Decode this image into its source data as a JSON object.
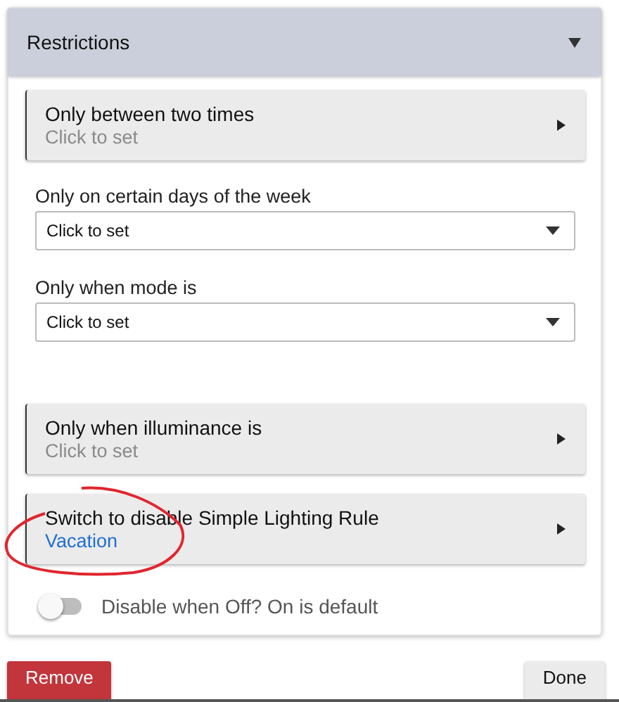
{
  "section": {
    "title": "Restrictions",
    "expanded": true
  },
  "items": [
    {
      "kind": "link",
      "label": "Only between two times",
      "value": "Click to set",
      "value_set": false
    },
    {
      "kind": "select",
      "label": "Only on certain days of the week",
      "value": "Click to set"
    },
    {
      "kind": "select",
      "label": "Only when mode is",
      "value": "Click to set"
    },
    {
      "kind": "link",
      "label": "Only when illuminance is",
      "value": "Click to set",
      "value_set": false
    },
    {
      "kind": "link",
      "label": "Switch to disable Simple Lighting Rule",
      "value": "Vacation",
      "value_set": true
    }
  ],
  "toggle": {
    "label": "Disable when Off? On is default",
    "on": false
  },
  "buttons": [
    {
      "kind": "danger",
      "label": "Remove"
    },
    {
      "kind": "plain",
      "label": "Done"
    }
  ]
}
